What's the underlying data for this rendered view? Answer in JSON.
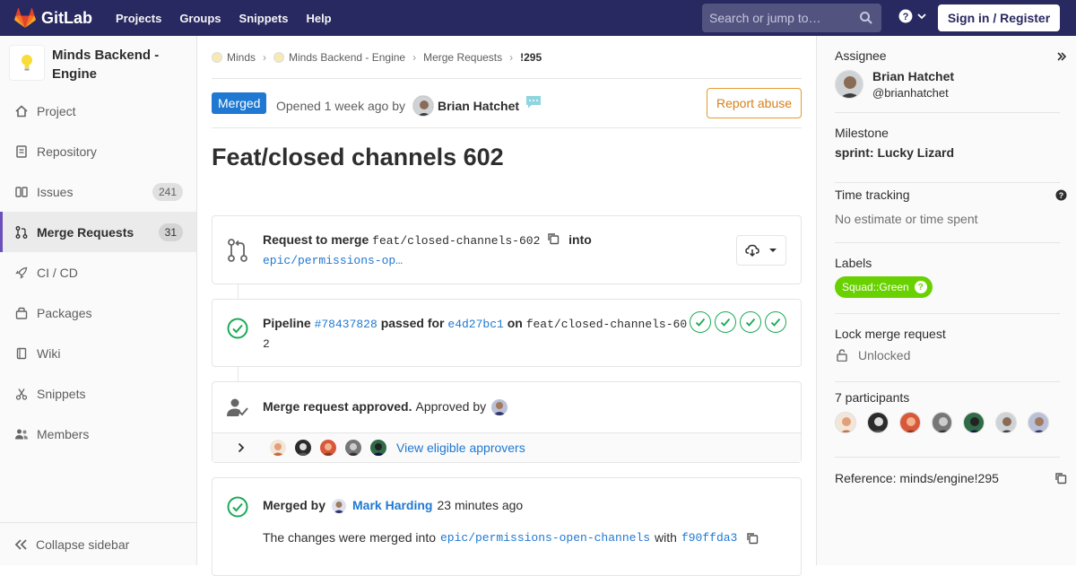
{
  "navbar": {
    "brand": "GitLab",
    "links": [
      "Projects",
      "Groups",
      "Snippets",
      "Help"
    ],
    "search_placeholder": "Search or jump to…",
    "signin": "Sign in / Register",
    "bg_color": "#292961"
  },
  "sidebar": {
    "project_name": "Minds Backend - Engine",
    "items": [
      {
        "label": "Project",
        "icon": "home-icon"
      },
      {
        "label": "Repository",
        "icon": "doc-icon"
      },
      {
        "label": "Issues",
        "icon": "issues-icon",
        "count": "241"
      },
      {
        "label": "Merge Requests",
        "icon": "merge-request-icon",
        "count": "31",
        "active": true
      },
      {
        "label": "CI / CD",
        "icon": "rocket-icon"
      },
      {
        "label": "Packages",
        "icon": "package-icon"
      },
      {
        "label": "Wiki",
        "icon": "book-icon"
      },
      {
        "label": "Snippets",
        "icon": "scissors-icon"
      },
      {
        "label": "Members",
        "icon": "users-icon"
      }
    ],
    "collapse": "Collapse sidebar",
    "accent": "#6b4fbb"
  },
  "breadcrumbs": [
    "Minds",
    "Minds Backend - Engine",
    "Merge Requests",
    "!295"
  ],
  "mr": {
    "status": "Merged",
    "opened_text": "Opened 1 week ago by",
    "author": "Brian Hatchet",
    "report_abuse": "Report abuse",
    "title": "Feat/closed channels 602",
    "request_to_merge": "Request to merge",
    "source_branch": "feat/closed-channels-602",
    "into": "into",
    "target_branch_short": "epic/permissions-op…",
    "pipeline_label": "Pipeline",
    "pipeline_id": "#78437828",
    "passed_for": "passed for",
    "commit": "e4d27bc1",
    "on": "on",
    "pipeline_branch": "feat/closed-channels-602",
    "approved_text": "Merge request approved.",
    "approved_by": "Approved by",
    "view_approvers": "View eligible approvers",
    "merged_by": "Merged by",
    "merger": "Mark Harding",
    "merged_when": "23 minutes ago",
    "merged_into_text": "The changes were merged into",
    "target_branch": "epic/permissions-open-channels",
    "with": "with",
    "merge_commit": "f90ffda3"
  },
  "right_sidebar": {
    "assignee_label": "Assignee",
    "assignee_name": "Brian Hatchet",
    "assignee_handle": "@brianhatchet",
    "milestone_label": "Milestone",
    "milestone": "sprint: Lucky Lizard",
    "time_label": "Time tracking",
    "time_value": "No estimate or time spent",
    "labels_label": "Labels",
    "label": "Squad::Green",
    "label_color": "#69d100",
    "lock_label": "Lock merge request",
    "lock_value": "Unlocked",
    "participants_label": "7 participants",
    "reference": "Reference: minds/engine!295"
  }
}
